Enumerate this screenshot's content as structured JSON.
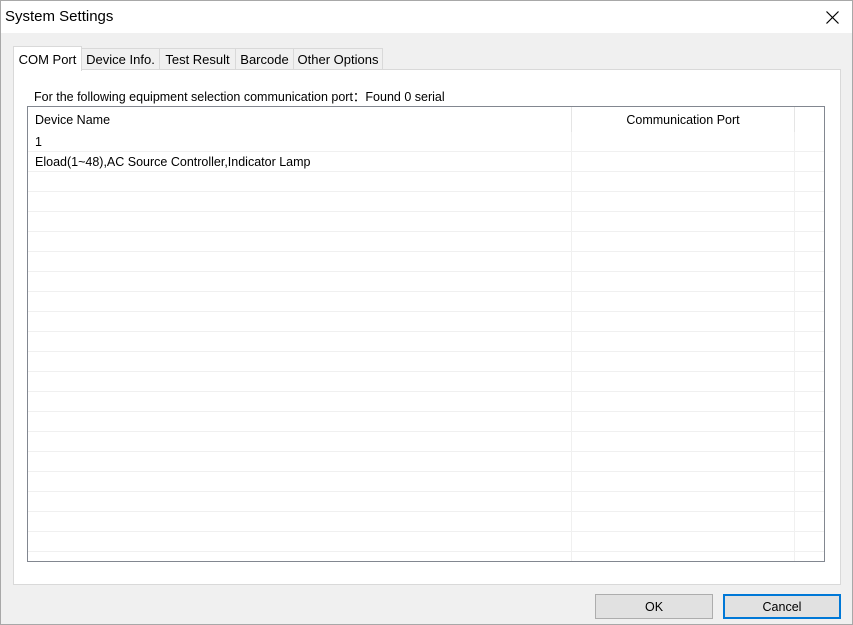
{
  "window": {
    "title": "System Settings"
  },
  "tabs": [
    {
      "label": "COM Port",
      "active": true
    },
    {
      "label": "Device Info.",
      "active": false
    },
    {
      "label": "Test Result",
      "active": false
    },
    {
      "label": "Barcode",
      "active": false
    },
    {
      "label": "Other Options",
      "active": false
    }
  ],
  "com_port": {
    "info_text": "For the following equipment selection communication port：Found 0 serial",
    "columns": [
      "Device Name",
      "Communication Port"
    ],
    "rows": [
      {
        "device_name": "1",
        "port": ""
      },
      {
        "device_name": "Eload(1~48),AC Source Controller,Indicator Lamp",
        "port": ""
      }
    ]
  },
  "buttons": {
    "ok": "OK",
    "cancel": "Cancel"
  },
  "colors": {
    "accent": "#0078d7",
    "list_border": "#828790"
  }
}
